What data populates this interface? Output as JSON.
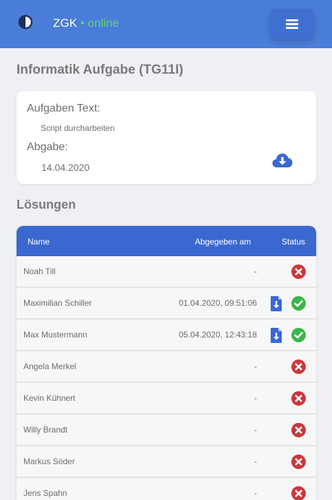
{
  "topbar": {
    "brand_name": "ZGK",
    "brand_separator": "•",
    "brand_status": "online",
    "theme_icon": "half-circle-contrast-icon",
    "menu_icon": "hamburger-menu-icon",
    "bar_color": "#4a7dd9",
    "status_color": "#5fd36a"
  },
  "page": {
    "title": "Informatik Aufgabe (TG11I)"
  },
  "assignment": {
    "text_label": "Aufgaben Text:",
    "text_value": "Script durcharbeiten",
    "due_label": "Abgabe:",
    "due_value": "14.04.2020",
    "download_icon": "cloud-download-icon"
  },
  "solutions": {
    "title": "Lösungen",
    "columns": [
      "Name",
      "Abgegeben am",
      "Status"
    ],
    "rows": [
      {
        "name": "Noah Till",
        "submitted": "-",
        "status": "missing"
      },
      {
        "name": "Maximilian Schiller",
        "submitted": "01.04.2020, 09:51:06",
        "status": "done"
      },
      {
        "name": "Max Mustermann",
        "submitted": "05.04.2020, 12:43:18",
        "status": "done"
      },
      {
        "name": "Angela Merkel",
        "submitted": "-",
        "status": "missing"
      },
      {
        "name": "Kevin Kühnert",
        "submitted": "-",
        "status": "missing"
      },
      {
        "name": "Willy Brandt",
        "submitted": "-",
        "status": "missing"
      },
      {
        "name": "Markus Söder",
        "submitted": "-",
        "status": "missing"
      },
      {
        "name": "Jens Spahn",
        "submitted": "-",
        "status": "missing"
      }
    ],
    "header_color": "#3a68d0",
    "done_color": "#3cb54a",
    "missing_color": "#c9383c",
    "file_icon_color": "#3a68d0"
  }
}
